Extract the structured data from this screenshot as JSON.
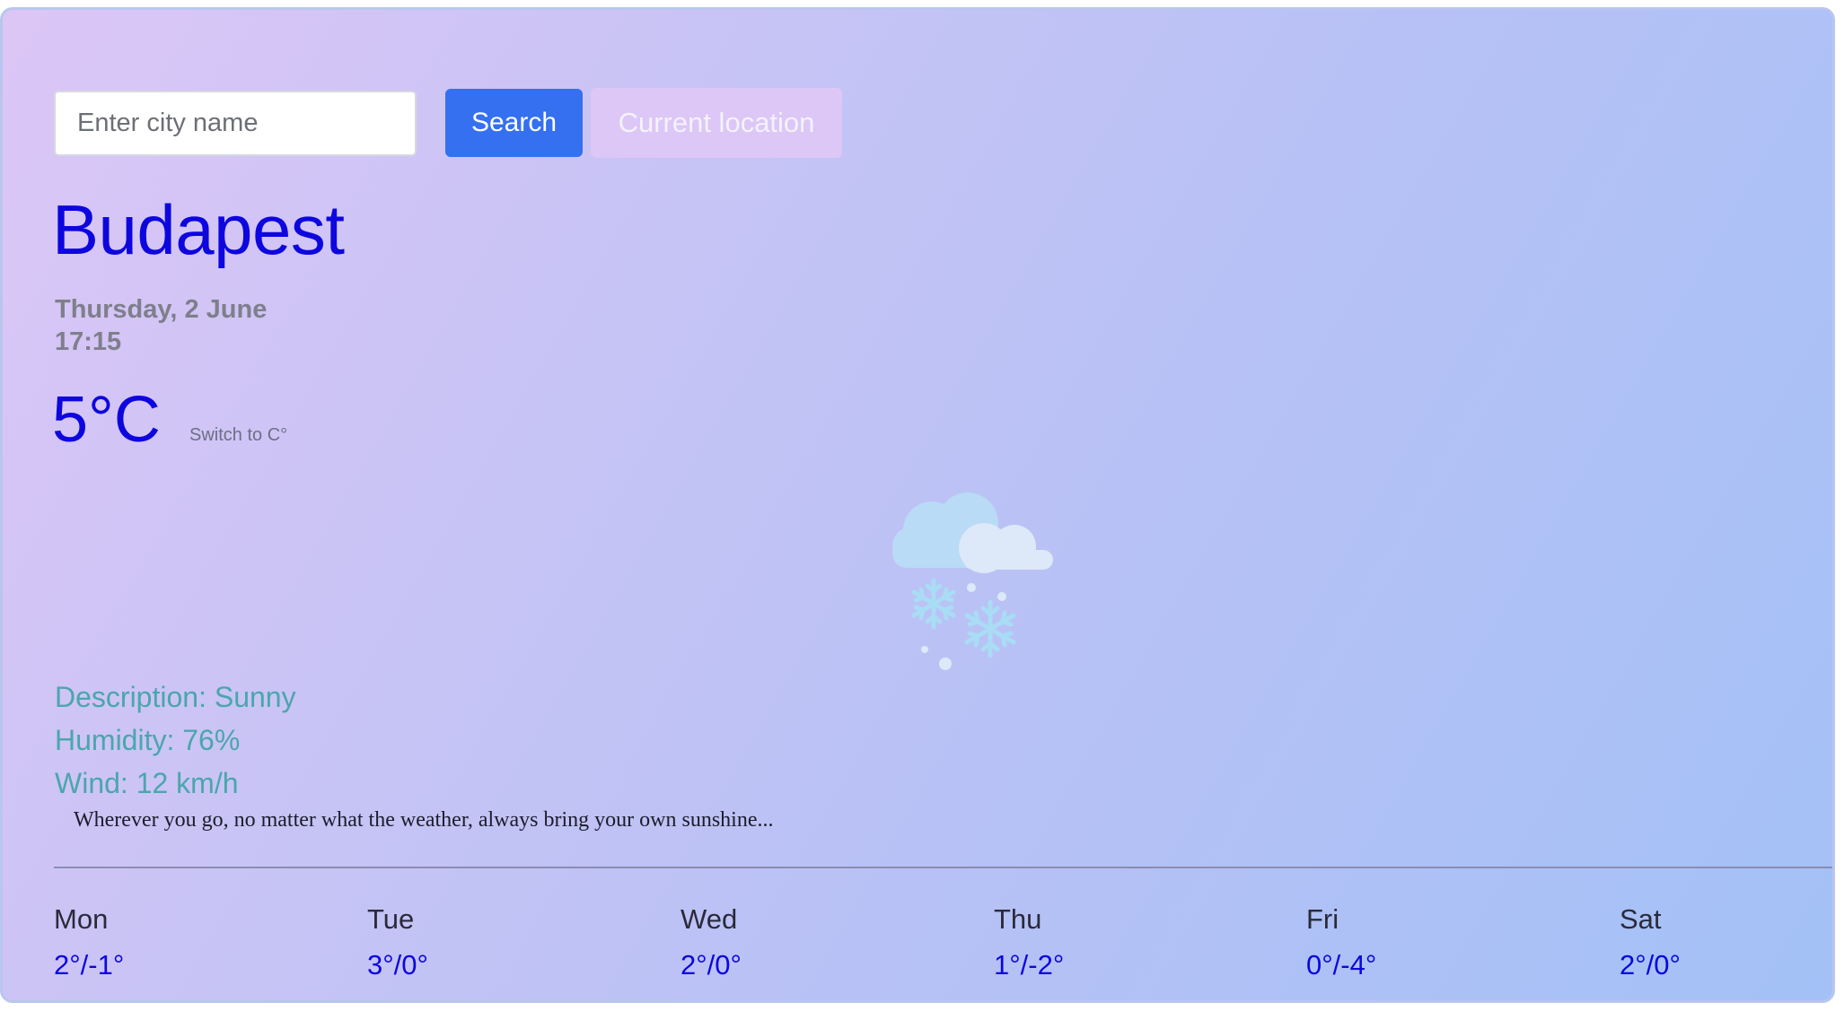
{
  "search": {
    "placeholder": "Enter city name",
    "search_label": "Search",
    "location_label": "Current location"
  },
  "current": {
    "city": "Budapest",
    "date": "Thursday, 2 June",
    "time": "17:15",
    "temperature": "5°C",
    "switch_label": "Switch to C°",
    "icon": "snow-cloud-icon",
    "description": "Description: Sunny",
    "humidity": "Humidity: 76%",
    "wind": "Wind: 12 km/h"
  },
  "quote": "Wherever you go, no matter what the weather, always bring your own sunshine...",
  "forecast": [
    {
      "day": "Mon",
      "temp": "2°/-1°"
    },
    {
      "day": "Tue",
      "temp": "3°/0°"
    },
    {
      "day": "Wed",
      "temp": "2°/0°"
    },
    {
      "day": "Thu",
      "temp": "1°/-2°"
    },
    {
      "day": "Fri",
      "temp": "0°/-4°"
    },
    {
      "day": "Sat",
      "temp": "2°/0°"
    }
  ],
  "colors": {
    "accent": "#0d06de",
    "search_button": "#3470f0",
    "location_button": "#dcc7f6",
    "detail_text": "#4ba6ad"
  }
}
